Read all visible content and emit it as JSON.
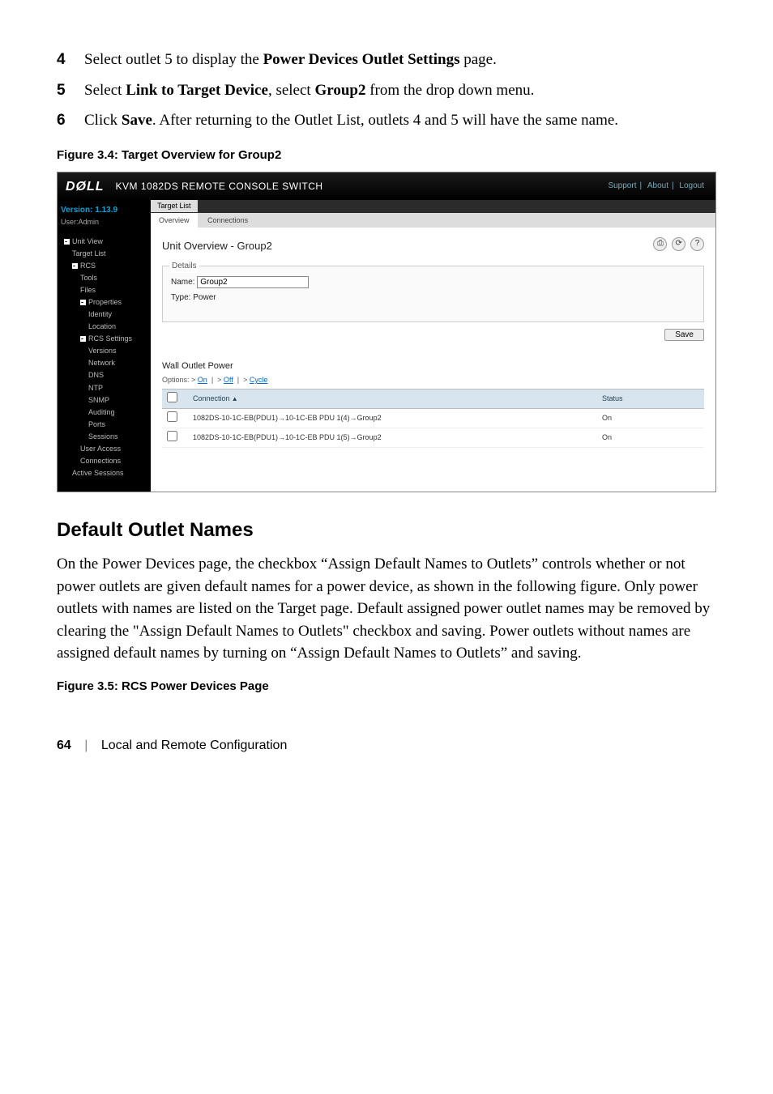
{
  "steps": [
    {
      "num": "4",
      "pre": "Select outlet 5 to display the ",
      "bold1": "Power Devices Outlet Settings",
      "mid1": " page.",
      "bold2": "",
      "mid2": "",
      "bold3": "",
      "post": ""
    },
    {
      "num": "5",
      "pre": "Select ",
      "bold1": "Link to Target Device",
      "mid1": ", select ",
      "bold2": "Group2",
      "mid2": " from the drop down menu.",
      "bold3": "",
      "post": ""
    },
    {
      "num": "6",
      "pre": "Click ",
      "bold1": "Save",
      "mid1": ". After returning to the Outlet List, outlets 4 and 5 will have the same name.",
      "bold2": "",
      "mid2": "",
      "bold3": "",
      "post": ""
    }
  ],
  "fig1_caption": "Figure 3.4: Target Overview for Group2",
  "ss": {
    "logo": "DØLL",
    "title": "KVM 1082DS REMOTE CONSOLE SWITCH",
    "hdr_links": {
      "support": "Support",
      "about": "About",
      "logout": "Logout"
    },
    "version": "Version: 1.13.9",
    "useradmin": "User:Admin",
    "tree": [
      {
        "lvl": 1,
        "box": true,
        "label": "Unit View"
      },
      {
        "lvl": 2,
        "box": false,
        "label": "Target List"
      },
      {
        "lvl": 2,
        "box": true,
        "label": "RCS"
      },
      {
        "lvl": 3,
        "box": false,
        "label": "Tools"
      },
      {
        "lvl": 3,
        "box": false,
        "label": "Files"
      },
      {
        "lvl": 3,
        "box": true,
        "label": "Properties"
      },
      {
        "lvl": 4,
        "box": false,
        "label": "Identity"
      },
      {
        "lvl": 4,
        "box": false,
        "label": "Location"
      },
      {
        "lvl": 3,
        "box": true,
        "label": "RCS Settings"
      },
      {
        "lvl": 4,
        "box": false,
        "label": "Versions"
      },
      {
        "lvl": 4,
        "box": false,
        "label": "Network"
      },
      {
        "lvl": 4,
        "box": false,
        "label": "DNS"
      },
      {
        "lvl": 4,
        "box": false,
        "label": "NTP"
      },
      {
        "lvl": 4,
        "box": false,
        "label": "SNMP"
      },
      {
        "lvl": 4,
        "box": false,
        "label": "Auditing"
      },
      {
        "lvl": 4,
        "box": false,
        "label": "Ports"
      },
      {
        "lvl": 4,
        "box": false,
        "label": "Sessions"
      },
      {
        "lvl": 3,
        "box": false,
        "label": "User Access"
      },
      {
        "lvl": 3,
        "box": false,
        "label": "Connections"
      },
      {
        "lvl": 2,
        "box": false,
        "label": "Active Sessions"
      }
    ],
    "tab1": "Target List",
    "subtab_overview": "Overview",
    "subtab_connections": "Connections",
    "panel_title": "Unit Overview - Group2",
    "details_legend": "Details",
    "name_label": "Name:",
    "name_value": "Group2",
    "type_label": "Type:",
    "type_value": "Power",
    "save_label": "Save",
    "wall_outlet": "Wall Outlet Power",
    "options_prefix": "Options: ",
    "opt_on": "On",
    "opt_off": "Off",
    "opt_cycle": "Cycle",
    "col_connection": "Connection",
    "col_status": "Status",
    "rows": [
      {
        "conn": "1082DS-10-1C-EB(PDU1)→10-1C-EB PDU 1(4)→Group2",
        "status": "On"
      },
      {
        "conn": "1082DS-10-1C-EB(PDU1)→10-1C-EB PDU 1(5)→Group2",
        "status": "On"
      }
    ],
    "icon_print": "⎙",
    "icon_refresh": "⟳",
    "icon_help": "?"
  },
  "h2": "Default Outlet Names",
  "para": "On the Power Devices page, the checkbox “Assign Default Names to Outlets” controls whether or not power outlets are given default names for a power device, as shown in the following figure. Only power outlets with names are listed on the Target page. Default assigned power outlet names may be removed by clearing the \"Assign Default Names to Outlets\" checkbox and saving. Power outlets without names are assigned default names by turning on “Assign Default Names to Outlets” and saving.",
  "fig2_caption": "Figure 3.5: RCS Power Devices Page",
  "footer": {
    "page": "64",
    "chapter": "Local and Remote Configuration"
  }
}
